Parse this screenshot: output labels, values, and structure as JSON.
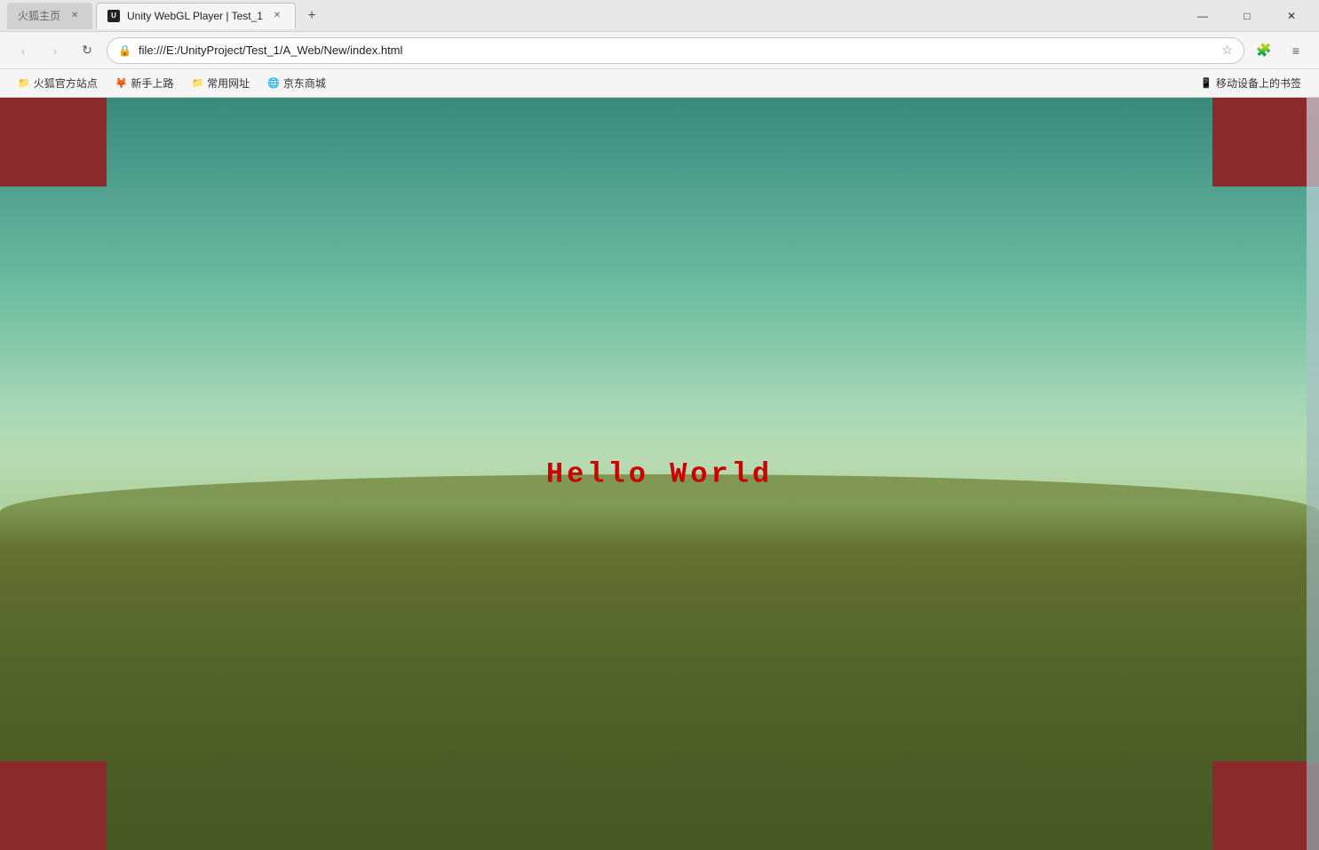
{
  "browser": {
    "tabs": [
      {
        "id": "tab1",
        "label": "火狐主页",
        "active": false,
        "hasIcon": false
      },
      {
        "id": "tab2",
        "label": "Unity WebGL Player | Test_1",
        "active": true,
        "hasIcon": true,
        "iconLabel": "U"
      }
    ],
    "new_tab_label": "+",
    "url": "file:///E:/UnityProject/Test_1/A_Web/New/index.html",
    "window_controls": {
      "minimize": "—",
      "maximize": "□",
      "close": "✕"
    }
  },
  "nav": {
    "back_label": "‹",
    "forward_label": "›",
    "refresh_label": "↻",
    "star_label": "☆",
    "extensions_label": "🧩",
    "menu_label": "≡"
  },
  "bookmarks": {
    "items": [
      {
        "icon": "📁",
        "label": "火狐官方站点"
      },
      {
        "icon": "🦊",
        "label": "新手上路"
      },
      {
        "icon": "📁",
        "label": "常用网址"
      },
      {
        "icon": "🌐",
        "label": "京东商城"
      }
    ],
    "right_item": {
      "icon": "📱",
      "label": "移动设备上的书签"
    }
  },
  "canvas": {
    "hello_world_text": "Hello  World",
    "text_color": "#cc0000"
  }
}
